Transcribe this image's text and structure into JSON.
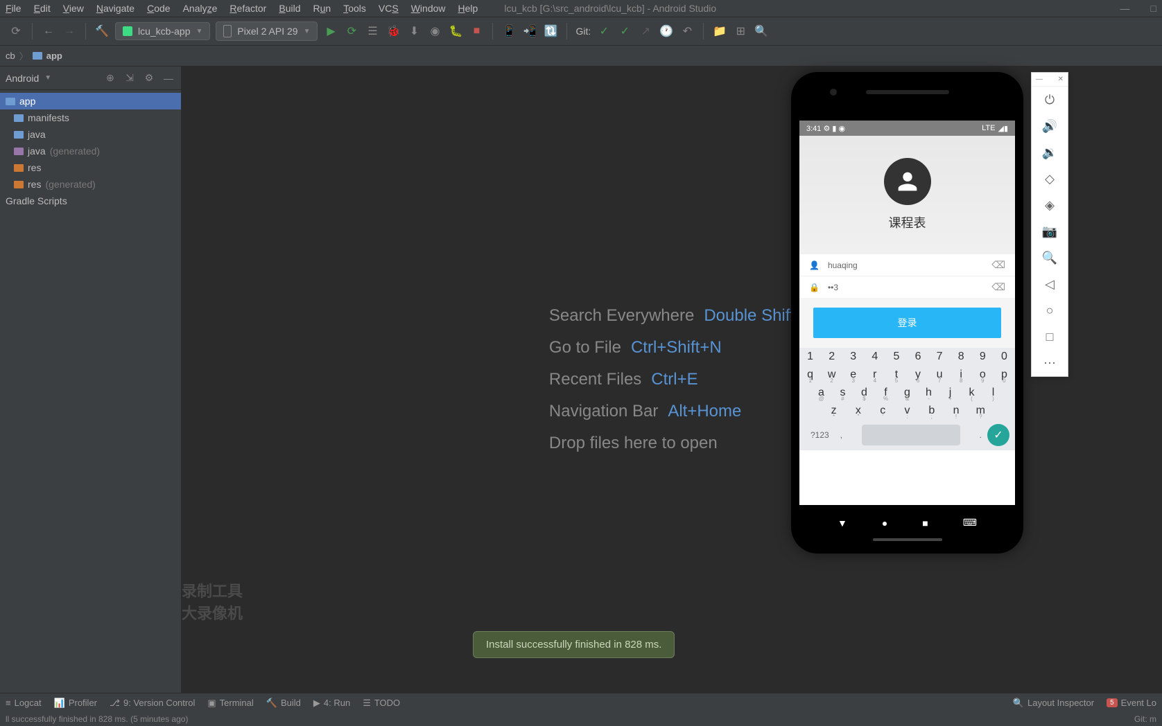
{
  "menu": [
    "File",
    "Edit",
    "View",
    "Navigate",
    "Code",
    "Analyze",
    "Refactor",
    "Build",
    "Run",
    "Tools",
    "VCS",
    "Window",
    "Help"
  ],
  "title": "lcu_kcb [G:\\src_android\\lcu_kcb] - Android Studio",
  "toolbar": {
    "config": "lcu_kcb-app",
    "device": "Pixel 2 API 29",
    "git_label": "Git:"
  },
  "nav": {
    "root": "cb",
    "app": "app"
  },
  "sidebar": {
    "view": "Android",
    "items": [
      {
        "label": "app",
        "selected": true,
        "level": 0
      },
      {
        "label": "manifests",
        "level": 1
      },
      {
        "label": "java",
        "level": 1
      },
      {
        "label": "java",
        "gen": "(generated)",
        "level": 1
      },
      {
        "label": "res",
        "level": 1
      },
      {
        "label": "res",
        "gen": "(generated)",
        "level": 1
      },
      {
        "label": "Gradle Scripts",
        "level": 0
      }
    ]
  },
  "shortcuts": [
    {
      "label": "Search Everywhere",
      "key": "Double Shift"
    },
    {
      "label": "Go to File",
      "key": "Ctrl+Shift+N"
    },
    {
      "label": "Recent Files",
      "key": "Ctrl+E"
    },
    {
      "label": "Navigation Bar",
      "key": "Alt+Home"
    },
    {
      "label": "Drop files here to open",
      "key": ""
    }
  ],
  "emulator": {
    "time": "3:41",
    "network": "LTE",
    "app_title": "课程表",
    "username": "huaqing",
    "password": "••3",
    "login_btn": "登录",
    "keyboard": {
      "row1": [
        "1",
        "2",
        "3",
        "4",
        "5",
        "6",
        "7",
        "8",
        "9",
        "0"
      ],
      "row2": [
        "q",
        "w",
        "e",
        "r",
        "t",
        "y",
        "u",
        "i",
        "o",
        "p"
      ],
      "row3": [
        "a",
        "s",
        "d",
        "f",
        "g",
        "h",
        "j",
        "k",
        "l"
      ],
      "row4": [
        "z",
        "x",
        "c",
        "v",
        "b",
        "n",
        "m"
      ],
      "sym": "?123",
      "comma": ",",
      "period": "."
    }
  },
  "watermark": {
    "line1": "录制工具",
    "line2": "大录像机"
  },
  "toast": "Install successfully finished in 828 ms.",
  "bottombar": {
    "left": [
      "Logcat",
      "Profiler",
      "9: Version Control",
      "Terminal",
      "Build",
      "4: Run",
      "TODO"
    ],
    "right": [
      "Layout Inspector",
      "Event Lo"
    ],
    "badge": "5"
  },
  "statusline": {
    "left": "ll successfully finished in 828 ms. (5 minutes ago)",
    "right": "Git: m"
  }
}
